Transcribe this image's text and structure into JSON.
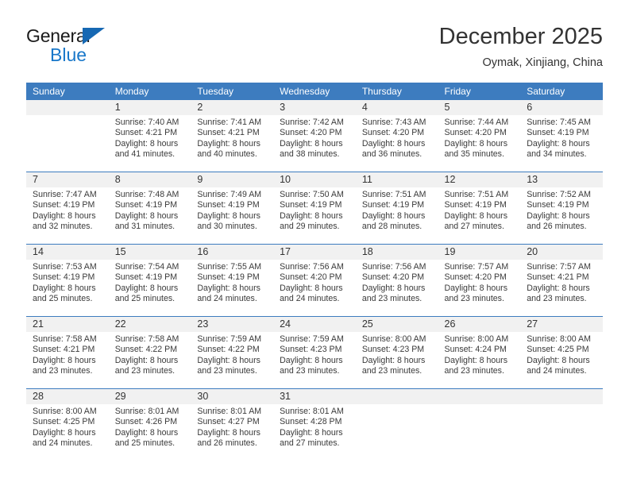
{
  "brand": {
    "name_top": "General",
    "name_bottom": "Blue",
    "triangle_color": "#1668b3",
    "blue_color": "#1877c9"
  },
  "header": {
    "title": "December 2025",
    "subtitle": "Oymak, Xinjiang, China"
  },
  "theme": {
    "header_bg": "#3d7cbf",
    "header_text": "#ffffff",
    "daynum_bg": "#f1f1f1",
    "grid_line": "#3d7cbf",
    "body_text": "#333333"
  },
  "weekday_headers": [
    "Sunday",
    "Monday",
    "Tuesday",
    "Wednesday",
    "Thursday",
    "Friday",
    "Saturday"
  ],
  "weeks": [
    [
      {
        "day": "",
        "sunrise": "",
        "sunset": "",
        "daylight1": "",
        "daylight2": ""
      },
      {
        "day": "1",
        "sunrise": "Sunrise: 7:40 AM",
        "sunset": "Sunset: 4:21 PM",
        "daylight1": "Daylight: 8 hours",
        "daylight2": "and 41 minutes."
      },
      {
        "day": "2",
        "sunrise": "Sunrise: 7:41 AM",
        "sunset": "Sunset: 4:21 PM",
        "daylight1": "Daylight: 8 hours",
        "daylight2": "and 40 minutes."
      },
      {
        "day": "3",
        "sunrise": "Sunrise: 7:42 AM",
        "sunset": "Sunset: 4:20 PM",
        "daylight1": "Daylight: 8 hours",
        "daylight2": "and 38 minutes."
      },
      {
        "day": "4",
        "sunrise": "Sunrise: 7:43 AM",
        "sunset": "Sunset: 4:20 PM",
        "daylight1": "Daylight: 8 hours",
        "daylight2": "and 36 minutes."
      },
      {
        "day": "5",
        "sunrise": "Sunrise: 7:44 AM",
        "sunset": "Sunset: 4:20 PM",
        "daylight1": "Daylight: 8 hours",
        "daylight2": "and 35 minutes."
      },
      {
        "day": "6",
        "sunrise": "Sunrise: 7:45 AM",
        "sunset": "Sunset: 4:19 PM",
        "daylight1": "Daylight: 8 hours",
        "daylight2": "and 34 minutes."
      }
    ],
    [
      {
        "day": "7",
        "sunrise": "Sunrise: 7:47 AM",
        "sunset": "Sunset: 4:19 PM",
        "daylight1": "Daylight: 8 hours",
        "daylight2": "and 32 minutes."
      },
      {
        "day": "8",
        "sunrise": "Sunrise: 7:48 AM",
        "sunset": "Sunset: 4:19 PM",
        "daylight1": "Daylight: 8 hours",
        "daylight2": "and 31 minutes."
      },
      {
        "day": "9",
        "sunrise": "Sunrise: 7:49 AM",
        "sunset": "Sunset: 4:19 PM",
        "daylight1": "Daylight: 8 hours",
        "daylight2": "and 30 minutes."
      },
      {
        "day": "10",
        "sunrise": "Sunrise: 7:50 AM",
        "sunset": "Sunset: 4:19 PM",
        "daylight1": "Daylight: 8 hours",
        "daylight2": "and 29 minutes."
      },
      {
        "day": "11",
        "sunrise": "Sunrise: 7:51 AM",
        "sunset": "Sunset: 4:19 PM",
        "daylight1": "Daylight: 8 hours",
        "daylight2": "and 28 minutes."
      },
      {
        "day": "12",
        "sunrise": "Sunrise: 7:51 AM",
        "sunset": "Sunset: 4:19 PM",
        "daylight1": "Daylight: 8 hours",
        "daylight2": "and 27 minutes."
      },
      {
        "day": "13",
        "sunrise": "Sunrise: 7:52 AM",
        "sunset": "Sunset: 4:19 PM",
        "daylight1": "Daylight: 8 hours",
        "daylight2": "and 26 minutes."
      }
    ],
    [
      {
        "day": "14",
        "sunrise": "Sunrise: 7:53 AM",
        "sunset": "Sunset: 4:19 PM",
        "daylight1": "Daylight: 8 hours",
        "daylight2": "and 25 minutes."
      },
      {
        "day": "15",
        "sunrise": "Sunrise: 7:54 AM",
        "sunset": "Sunset: 4:19 PM",
        "daylight1": "Daylight: 8 hours",
        "daylight2": "and 25 minutes."
      },
      {
        "day": "16",
        "sunrise": "Sunrise: 7:55 AM",
        "sunset": "Sunset: 4:19 PM",
        "daylight1": "Daylight: 8 hours",
        "daylight2": "and 24 minutes."
      },
      {
        "day": "17",
        "sunrise": "Sunrise: 7:56 AM",
        "sunset": "Sunset: 4:20 PM",
        "daylight1": "Daylight: 8 hours",
        "daylight2": "and 24 minutes."
      },
      {
        "day": "18",
        "sunrise": "Sunrise: 7:56 AM",
        "sunset": "Sunset: 4:20 PM",
        "daylight1": "Daylight: 8 hours",
        "daylight2": "and 23 minutes."
      },
      {
        "day": "19",
        "sunrise": "Sunrise: 7:57 AM",
        "sunset": "Sunset: 4:20 PM",
        "daylight1": "Daylight: 8 hours",
        "daylight2": "and 23 minutes."
      },
      {
        "day": "20",
        "sunrise": "Sunrise: 7:57 AM",
        "sunset": "Sunset: 4:21 PM",
        "daylight1": "Daylight: 8 hours",
        "daylight2": "and 23 minutes."
      }
    ],
    [
      {
        "day": "21",
        "sunrise": "Sunrise: 7:58 AM",
        "sunset": "Sunset: 4:21 PM",
        "daylight1": "Daylight: 8 hours",
        "daylight2": "and 23 minutes."
      },
      {
        "day": "22",
        "sunrise": "Sunrise: 7:58 AM",
        "sunset": "Sunset: 4:22 PM",
        "daylight1": "Daylight: 8 hours",
        "daylight2": "and 23 minutes."
      },
      {
        "day": "23",
        "sunrise": "Sunrise: 7:59 AM",
        "sunset": "Sunset: 4:22 PM",
        "daylight1": "Daylight: 8 hours",
        "daylight2": "and 23 minutes."
      },
      {
        "day": "24",
        "sunrise": "Sunrise: 7:59 AM",
        "sunset": "Sunset: 4:23 PM",
        "daylight1": "Daylight: 8 hours",
        "daylight2": "and 23 minutes."
      },
      {
        "day": "25",
        "sunrise": "Sunrise: 8:00 AM",
        "sunset": "Sunset: 4:23 PM",
        "daylight1": "Daylight: 8 hours",
        "daylight2": "and 23 minutes."
      },
      {
        "day": "26",
        "sunrise": "Sunrise: 8:00 AM",
        "sunset": "Sunset: 4:24 PM",
        "daylight1": "Daylight: 8 hours",
        "daylight2": "and 23 minutes."
      },
      {
        "day": "27",
        "sunrise": "Sunrise: 8:00 AM",
        "sunset": "Sunset: 4:25 PM",
        "daylight1": "Daylight: 8 hours",
        "daylight2": "and 24 minutes."
      }
    ],
    [
      {
        "day": "28",
        "sunrise": "Sunrise: 8:00 AM",
        "sunset": "Sunset: 4:25 PM",
        "daylight1": "Daylight: 8 hours",
        "daylight2": "and 24 minutes."
      },
      {
        "day": "29",
        "sunrise": "Sunrise: 8:01 AM",
        "sunset": "Sunset: 4:26 PM",
        "daylight1": "Daylight: 8 hours",
        "daylight2": "and 25 minutes."
      },
      {
        "day": "30",
        "sunrise": "Sunrise: 8:01 AM",
        "sunset": "Sunset: 4:27 PM",
        "daylight1": "Daylight: 8 hours",
        "daylight2": "and 26 minutes."
      },
      {
        "day": "31",
        "sunrise": "Sunrise: 8:01 AM",
        "sunset": "Sunset: 4:28 PM",
        "daylight1": "Daylight: 8 hours",
        "daylight2": "and 27 minutes."
      },
      {
        "day": "",
        "sunrise": "",
        "sunset": "",
        "daylight1": "",
        "daylight2": ""
      },
      {
        "day": "",
        "sunrise": "",
        "sunset": "",
        "daylight1": "",
        "daylight2": ""
      },
      {
        "day": "",
        "sunrise": "",
        "sunset": "",
        "daylight1": "",
        "daylight2": ""
      }
    ]
  ]
}
